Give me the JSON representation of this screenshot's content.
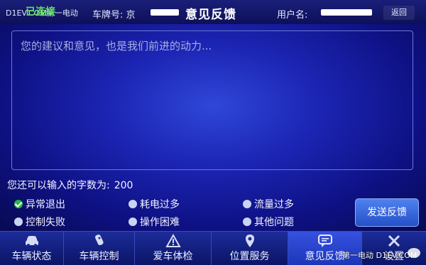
{
  "watermark_top": "D1EV.COM第一电动",
  "header": {
    "connection_status": "已连接",
    "plate_label": "车牌号: 京",
    "title": "意见反馈",
    "user_label": "用户名:",
    "back_label": "返回"
  },
  "feedback": {
    "placeholder": "您的建议和意见，也是我们前进的动力...",
    "counter_label": "您还可以输入的字数为:",
    "counter_value": "200"
  },
  "options": [
    {
      "label": "异常退出",
      "checked": true
    },
    {
      "label": "耗电过多",
      "checked": false
    },
    {
      "label": "流量过多",
      "checked": false
    },
    {
      "label": "控制失败",
      "checked": false
    },
    {
      "label": "操作困难",
      "checked": false
    },
    {
      "label": "其他问题",
      "checked": false
    }
  ],
  "submit_label": "发送反馈",
  "nav": [
    {
      "label": "车辆状态",
      "icon": "car-icon"
    },
    {
      "label": "车辆控制",
      "icon": "key-fob-icon"
    },
    {
      "label": "爱车体检",
      "icon": "warning-triangle-icon"
    },
    {
      "label": "位置服务",
      "icon": "location-pin-icon"
    },
    {
      "label": "意见反馈",
      "icon": "chat-bubble-icon",
      "active": true
    },
    {
      "label": "设置",
      "icon": "tools-icon"
    }
  ],
  "watermark_bottom": "第一电动 D1EV.COM",
  "colors": {
    "accent": "#2550c8",
    "checked": "#2bb843",
    "status": "#5fe061"
  }
}
